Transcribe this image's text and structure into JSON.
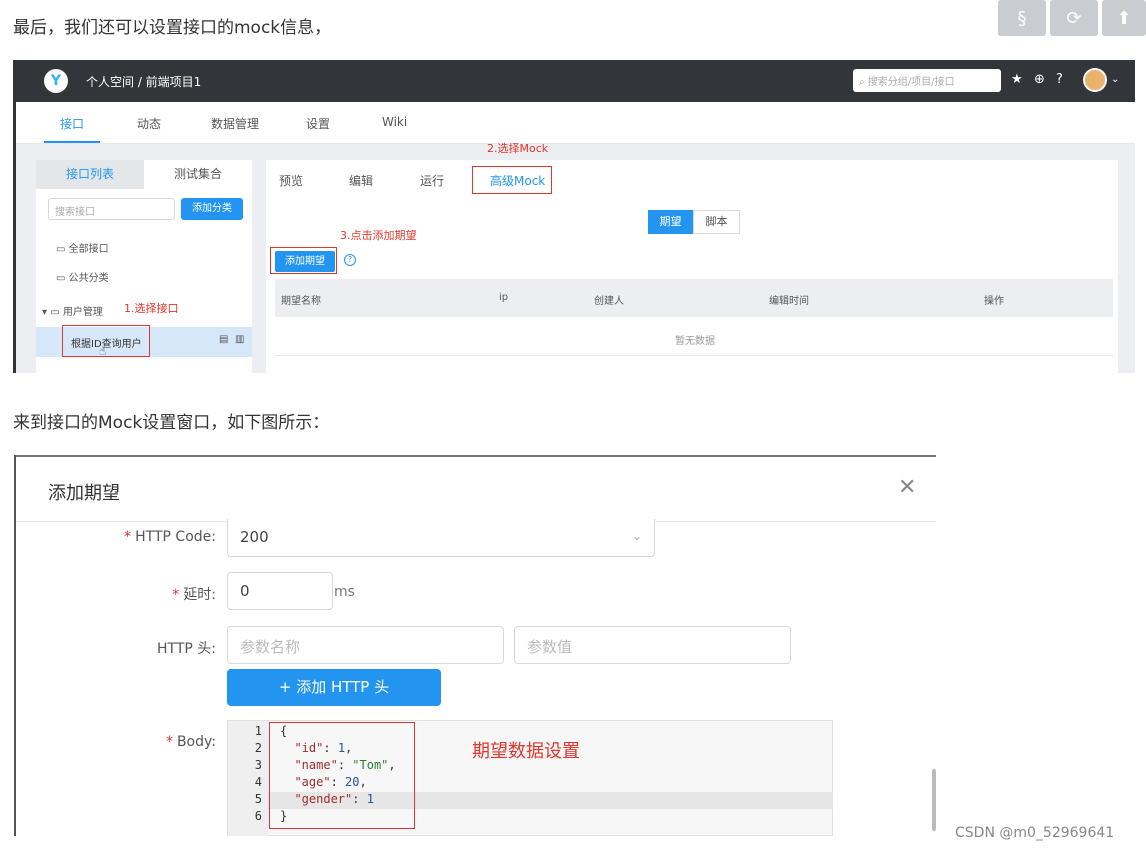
{
  "article": {
    "para1": "最后，我们还可以设置接口的mock信息，",
    "para2": "来到接口的Mock设置窗口，如下图所示：",
    "watermark": "CSDN @m0_52969641"
  },
  "float_buttons": [
    {
      "icon": "section-icon",
      "glyph": "§"
    },
    {
      "icon": "refresh-icon",
      "glyph": "⟳"
    },
    {
      "icon": "arrow-up-icon",
      "glyph": "⬆"
    }
  ],
  "shot1": {
    "breadcrumb": "个人空间 / 前端项目1",
    "search_placeholder": "搜索分组/项目/接口",
    "nav_tabs": [
      "接口",
      "动态",
      "数据管理",
      "设置",
      "Wiki"
    ],
    "left_tabs": [
      "接口列表",
      "测试集合"
    ],
    "left_search_placeholder": "搜索接口",
    "left_add_button": "添加分类",
    "tree": [
      "全部接口",
      "公共分类",
      "用户管理"
    ],
    "selected_api": "根据ID查询用户",
    "right_tabs": [
      "预览",
      "编辑",
      "运行",
      "高级Mock"
    ],
    "segment": [
      "期望",
      "脚本"
    ],
    "add_expectation_button": "添加期望",
    "table_headers": [
      "期望名称",
      "ip",
      "创建人",
      "编辑时间",
      "操作"
    ],
    "no_data": "暂无数据",
    "annotations": {
      "step1": "1.选择接口",
      "step2": "2.选择Mock",
      "step3": "3.点击添加期望"
    }
  },
  "shot2": {
    "title": "添加期望",
    "http_code_label": "HTTP Code",
    "http_code_value": "200",
    "delay_label": "延时",
    "delay_value": "0",
    "delay_unit": "ms",
    "header_label": "HTTP 头",
    "header_name_placeholder": "参数名称",
    "header_value_placeholder": "参数值",
    "add_header_button": "+  添加 HTTP 头",
    "body_label": "Body",
    "code_lines": [
      "1",
      "2",
      "3",
      "4",
      "5",
      "6"
    ],
    "annotation": "期望数据设置"
  }
}
